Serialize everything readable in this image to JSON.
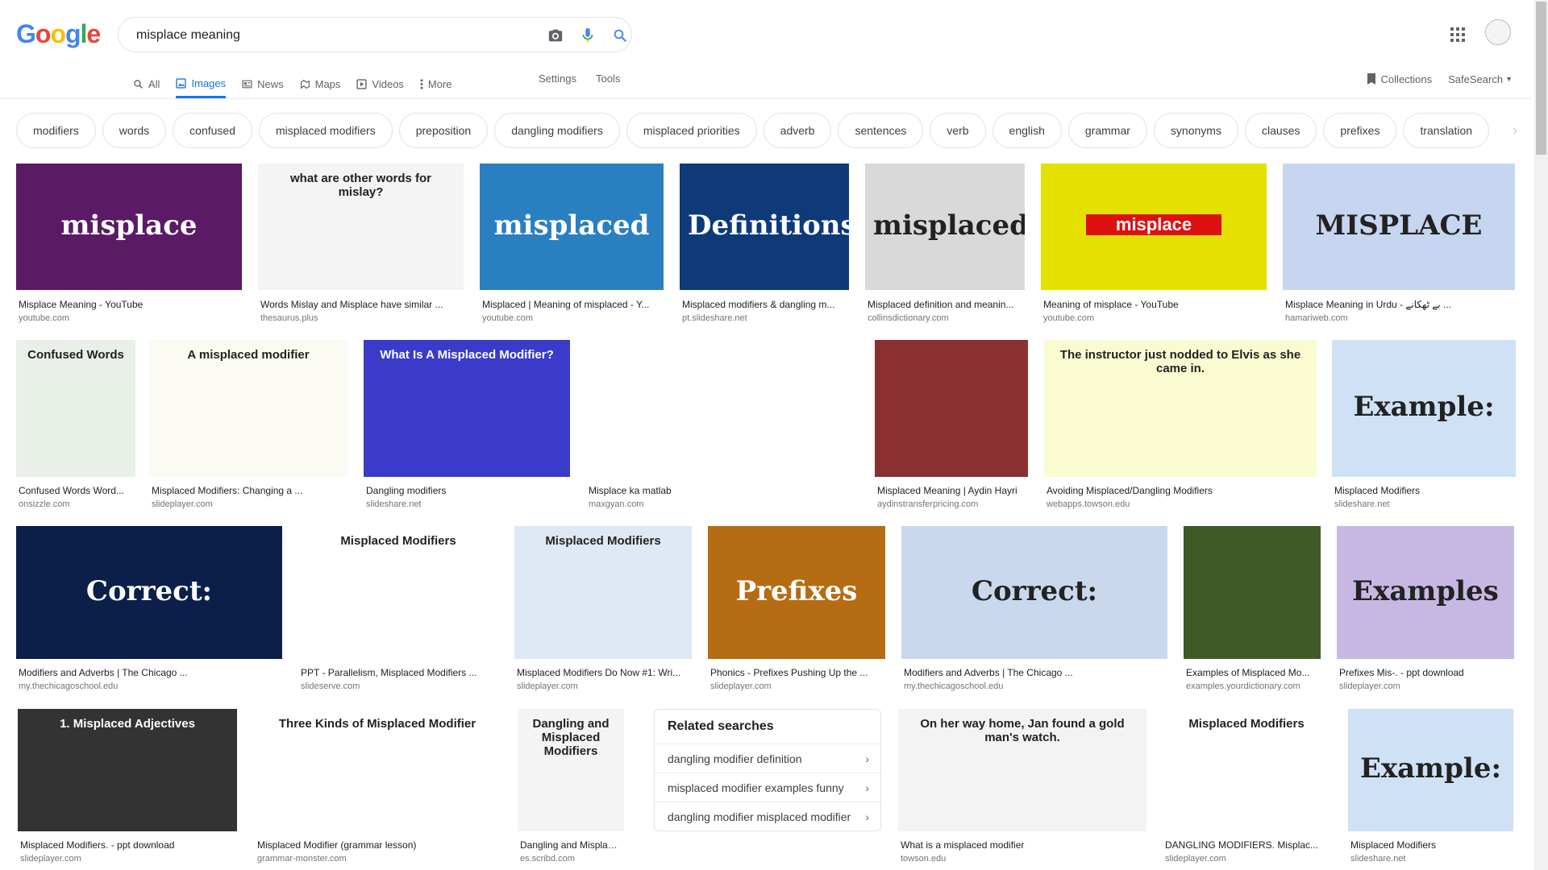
{
  "logo": {
    "letters": [
      {
        "c": "G",
        "color": "#4285F4"
      },
      {
        "c": "o",
        "color": "#EA4335"
      },
      {
        "c": "o",
        "color": "#FBBC05"
      },
      {
        "c": "g",
        "color": "#4285F4"
      },
      {
        "c": "l",
        "color": "#34A853"
      },
      {
        "c": "e",
        "color": "#EA4335"
      }
    ]
  },
  "search": {
    "query": "misplace meaning"
  },
  "tabs": [
    {
      "label": "All",
      "icon": "search-icon"
    },
    {
      "label": "Images",
      "icon": "image-icon",
      "active": true
    },
    {
      "label": "News",
      "icon": "news-icon"
    },
    {
      "label": "Maps",
      "icon": "map-icon"
    },
    {
      "label": "Videos",
      "icon": "video-icon"
    },
    {
      "label": "More",
      "icon": "more-vert-icon"
    }
  ],
  "tools": {
    "settings": "Settings",
    "tools": "Tools"
  },
  "right": {
    "collections": "Collections",
    "safesearch": "SafeSearch"
  },
  "chips": [
    "modifiers",
    "words",
    "confused",
    "misplaced modifiers",
    "preposition",
    "dangling modifiers",
    "misplaced priorities",
    "adverb",
    "sentences",
    "verb",
    "english",
    "grammar",
    "synonyms",
    "clauses",
    "prefixes",
    "translation"
  ],
  "results": {
    "r1": [
      {
        "caption": "Misplace Meaning - YouTube",
        "source": "youtube.com",
        "thumb": "misplace",
        "bg": "#5b1a66"
      },
      {
        "caption": "Words Mislay and Misplace have similar ...",
        "source": "thesaurus.plus",
        "thumb": "what are other words for mislay?",
        "bg": "#f4f4f4"
      },
      {
        "caption": "Misplaced | Meaning of misplaced - Y...",
        "source": "youtube.com",
        "thumb": "misplaced",
        "bg": "#2a7fc0"
      },
      {
        "caption": "Misplaced modifiers & dangling m...",
        "source": "pt.slideshare.net",
        "thumb": "Definitions",
        "bg": "#0e3a7a"
      },
      {
        "caption": "Misplaced definition and meanin...",
        "source": "collinsdictionary.com",
        "thumb": "misplaced",
        "bg": "#d9d9d9"
      },
      {
        "caption": "Meaning of misplace - YouTube",
        "source": "youtube.com",
        "thumb": "misplace",
        "bg": "#e4e000"
      },
      {
        "caption": "Misplace Meaning in Urdu - بے ٹھکانے ...",
        "source": "hamariweb.com",
        "thumb": "MISPLACE",
        "bg": "#c6d6f0"
      }
    ],
    "r2": [
      {
        "caption": "Confused Words Word...",
        "source": "onsizzle.com",
        "thumb": "Confused Words",
        "bg": "#e8f0e8"
      },
      {
        "caption": "Misplaced Modifiers: Changing a ...",
        "source": "slideplayer.com",
        "thumb": "A misplaced modifier",
        "bg": "#fbfbf3"
      },
      {
        "caption": "Dangling modifiers",
        "source": "slideshare.net",
        "thumb": "What Is A Misplaced Modifier?",
        "bg": "#3b3bc9"
      },
      {
        "caption": "Misplace ka matlab",
        "source": "maxgyan.com",
        "thumb": "",
        "bg": "#ffffff"
      },
      {
        "caption": "Misplaced Meaning | Aydin Hayri",
        "source": "aydinstransferpricing.com",
        "thumb": "",
        "bg": "#8a3030"
      },
      {
        "caption": "Avoiding Misplaced/Dangling Modifiers",
        "source": "webapps.towson.edu",
        "thumb": "The instructor just nodded to Elvis as she came in.",
        "bg": "#fbfbd2"
      },
      {
        "caption": "Misplaced Modifiers",
        "source": "slideshare.net",
        "thumb": "Example:",
        "bg": "#cfe2f5"
      }
    ],
    "r3": [
      {
        "caption": "Modifiers and Adverbs | The Chicago ...",
        "source": "my.thechicagoschool.edu",
        "thumb": "Correct:",
        "bg": "#0b1f4a"
      },
      {
        "caption": "PPT - Parallelism, Misplaced Modifiers ...",
        "source": "slideserve.com",
        "thumb": "Misplaced Modifiers",
        "bg": "#ffffff"
      },
      {
        "caption": "Misplaced Modifiers Do Now #1: Wri...",
        "source": "slideplayer.com",
        "thumb": "Misplaced Modifiers",
        "bg": "#dfe8f5"
      },
      {
        "caption": "Phonics - Prefixes Pushing Up the ...",
        "source": "slideplayer.com",
        "thumb": "Prefixes",
        "bg": "#b56c12"
      },
      {
        "caption": "Modifiers and Adverbs | The Chicago ...",
        "source": "my.thechicagoschool.edu",
        "thumb": "Correct:",
        "bg": "#c9d8ec"
      },
      {
        "caption": "Examples of Misplaced Mo...",
        "source": "examples.yourdictionary.com",
        "thumb": "",
        "bg": "#3e5a28"
      },
      {
        "caption": "Prefixes Mis-. - ppt download",
        "source": "slideplayer.com",
        "thumb": "Examples",
        "bg": "#c7b8e3"
      }
    ],
    "r4": [
      {
        "caption": "Misplaced Modifiers. - ppt download",
        "source": "slideplayer.com",
        "thumb": "1. Misplaced Adjectives",
        "bg": "#333333"
      },
      {
        "caption": "Misplaced Modifier (grammar lesson)",
        "source": "grammar-monster.com",
        "thumb": "Three Kinds of Misplaced Modifier",
        "bg": "#ffffff"
      },
      {
        "caption": "Dangling and Misplace...",
        "source": "es.scribd.com",
        "thumb": "Dangling and Misplaced Modifiers",
        "bg": "#f4f4f4"
      },
      {
        "caption": "What is a misplaced modifier",
        "source": "towson.edu",
        "thumb": "On her way home, Jan found a gold man's watch.",
        "bg": "#f3f3f3"
      },
      {
        "caption": "DANGLING MODIFIERS. Misplac...",
        "source": "slideplayer.com",
        "thumb": "Misplaced Modifiers",
        "bg": "#ffffff"
      },
      {
        "caption": "Misplaced Modifiers",
        "source": "slideshare.net",
        "thumb": "Example:",
        "bg": "#cfe2f5"
      }
    ]
  },
  "related": {
    "title": "Related searches",
    "items": [
      "dangling modifier definition",
      "misplaced modifier examples funny",
      "dangling modifier misplaced modifier"
    ]
  }
}
